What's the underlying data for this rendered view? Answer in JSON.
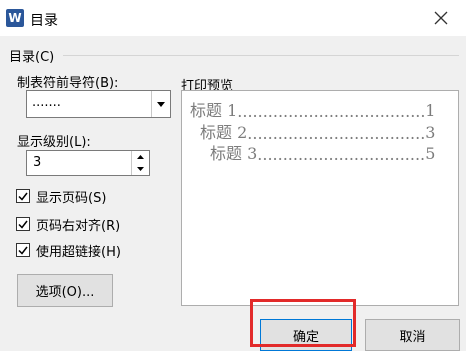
{
  "window": {
    "title": "目录",
    "app_icon": "W"
  },
  "group": {
    "title": "目录(C)"
  },
  "leader": {
    "label": "制表符前导符(B):",
    "value": "......."
  },
  "levels": {
    "label": "显示级别(L):",
    "value": "3"
  },
  "options": [
    {
      "label": "显示页码(S)",
      "checked": true
    },
    {
      "label": "页码右对齐(R)",
      "checked": true
    },
    {
      "label": "使用超链接(H)",
      "checked": true
    }
  ],
  "options_button": "选项(O)...",
  "preview": {
    "label": "打印预览",
    "entries": [
      {
        "text": "标题 1",
        "page": "1"
      },
      {
        "text": "标题 2",
        "page": "3"
      },
      {
        "text": "标题 3",
        "page": "5"
      }
    ]
  },
  "buttons": {
    "ok": "确定",
    "cancel": "取消"
  },
  "colors": {
    "highlight": "#e22a2a",
    "app_icon": "#2b579a"
  }
}
